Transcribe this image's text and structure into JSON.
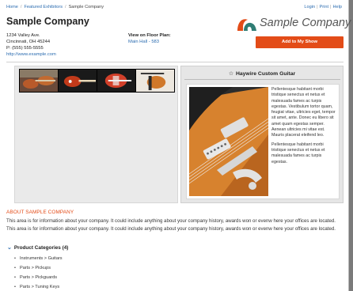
{
  "breadcrumb": {
    "items": [
      "Home",
      "Featured Exhibitors",
      "Sample Company"
    ],
    "separator": "/"
  },
  "top_links": {
    "login": "Login",
    "print": "Print",
    "help": "Help",
    "separator": "|"
  },
  "company": {
    "name": "Sample Company",
    "address_line1": "1234 Valley Ave.",
    "address_line2": "Cincinnati, OH 45244",
    "phone": "P: (555) 555-5555",
    "website": "http://www.example.com"
  },
  "floor_plan": {
    "label": "View on Floor Plan:",
    "link": "Main Hall - 583"
  },
  "logo": {
    "text": "Sample Company",
    "icon": "wave-logo-icon",
    "colors": {
      "orange": "#e34c18",
      "teal": "#2f7d74"
    }
  },
  "actions": {
    "add_to_show": "Add to My Show"
  },
  "gallery": {
    "thumbnails": [
      "guitar-thumb-1",
      "guitar-thumb-2",
      "guitar-thumb-3",
      "guitar-thumb-4"
    ]
  },
  "featured": {
    "icon": "star-outline-icon",
    "title": "Haywire Custom Guitar",
    "paragraph1": "Pellentesque habitant morbi tristique senectus et netus et malesuada fames ac turpis egestas. Vestibulum tortor quam, feugiat vitae, ultricies eget, tempor sit amet, ante. Donec eu libero sit amet quam egestas semper. Aenean ultricies mi vitae est. Mauris placerat eleifend leo.",
    "paragraph2": "Pellentesque habitant morbi tristique senectus et netus et malesuada fames ac turpis egestas."
  },
  "about": {
    "heading": "ABOUT SAMPLE COMPANY",
    "text": "This area is for information about your company. It could include anything about your company history, awards won or evenw here your offices are located. This area is for information about your company. It could include anything about your company history, awards won or evenw here your offices are located."
  },
  "categories": {
    "heading": "Product Categories (4)",
    "icon": "chevron-down-icon",
    "items": [
      "Instruments > Guitars",
      "Parts > Pickups",
      "Parts > Pickguards",
      "Parts > Tuning Keys"
    ]
  },
  "colors": {
    "accent": "#e34c18",
    "link": "#2b6cb0"
  }
}
